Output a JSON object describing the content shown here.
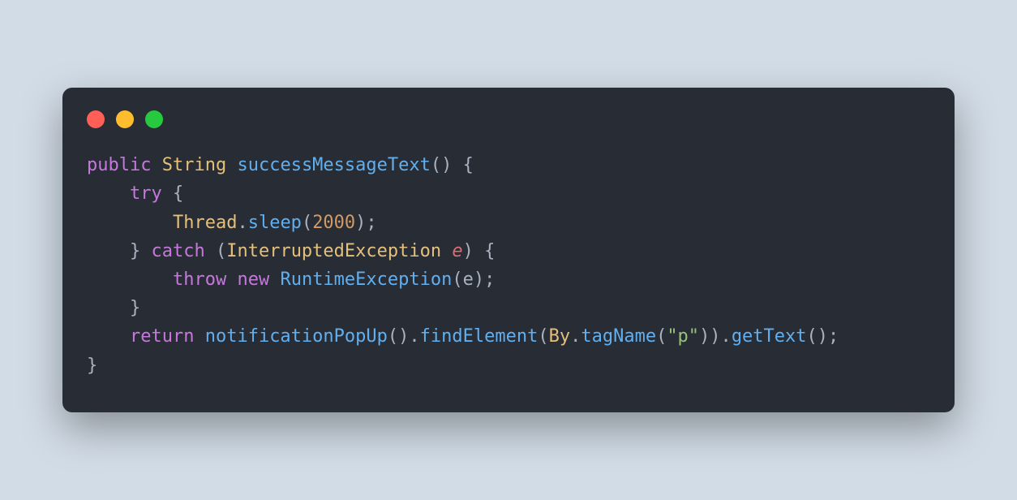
{
  "code": {
    "tokens": {
      "t1": "public",
      "t2": "String",
      "t3": "successMessageText",
      "t4": "() {",
      "t5": "try",
      "t6": " {",
      "t7": "Thread",
      "t8": ".",
      "t9": "sleep",
      "t10": "(",
      "t11": "2000",
      "t12": ");",
      "t13": "} ",
      "t14": "catch",
      "t15": " (",
      "t16": "InterruptedException",
      "t17": " ",
      "t18": "e",
      "t19": ") {",
      "t20": "throw",
      "t21": " ",
      "t22": "new",
      "t23": " ",
      "t24": "RuntimeException",
      "t25": "(e);",
      "t26": "}",
      "t27": "return",
      "t28": " ",
      "t29": "notificationPopUp",
      "t30": "().",
      "t31": "findElement",
      "t32": "(",
      "t33": "By",
      "t34": ".",
      "t35": "tagName",
      "t36": "(",
      "t37": "\"p\"",
      "t38": ")).",
      "t39": "getText",
      "t40": "();",
      "t41": "}"
    }
  },
  "window": {
    "colors": {
      "close": "#ff5f56",
      "minimize": "#ffbd2e",
      "zoom": "#27c93f",
      "background": "#282c34"
    }
  }
}
